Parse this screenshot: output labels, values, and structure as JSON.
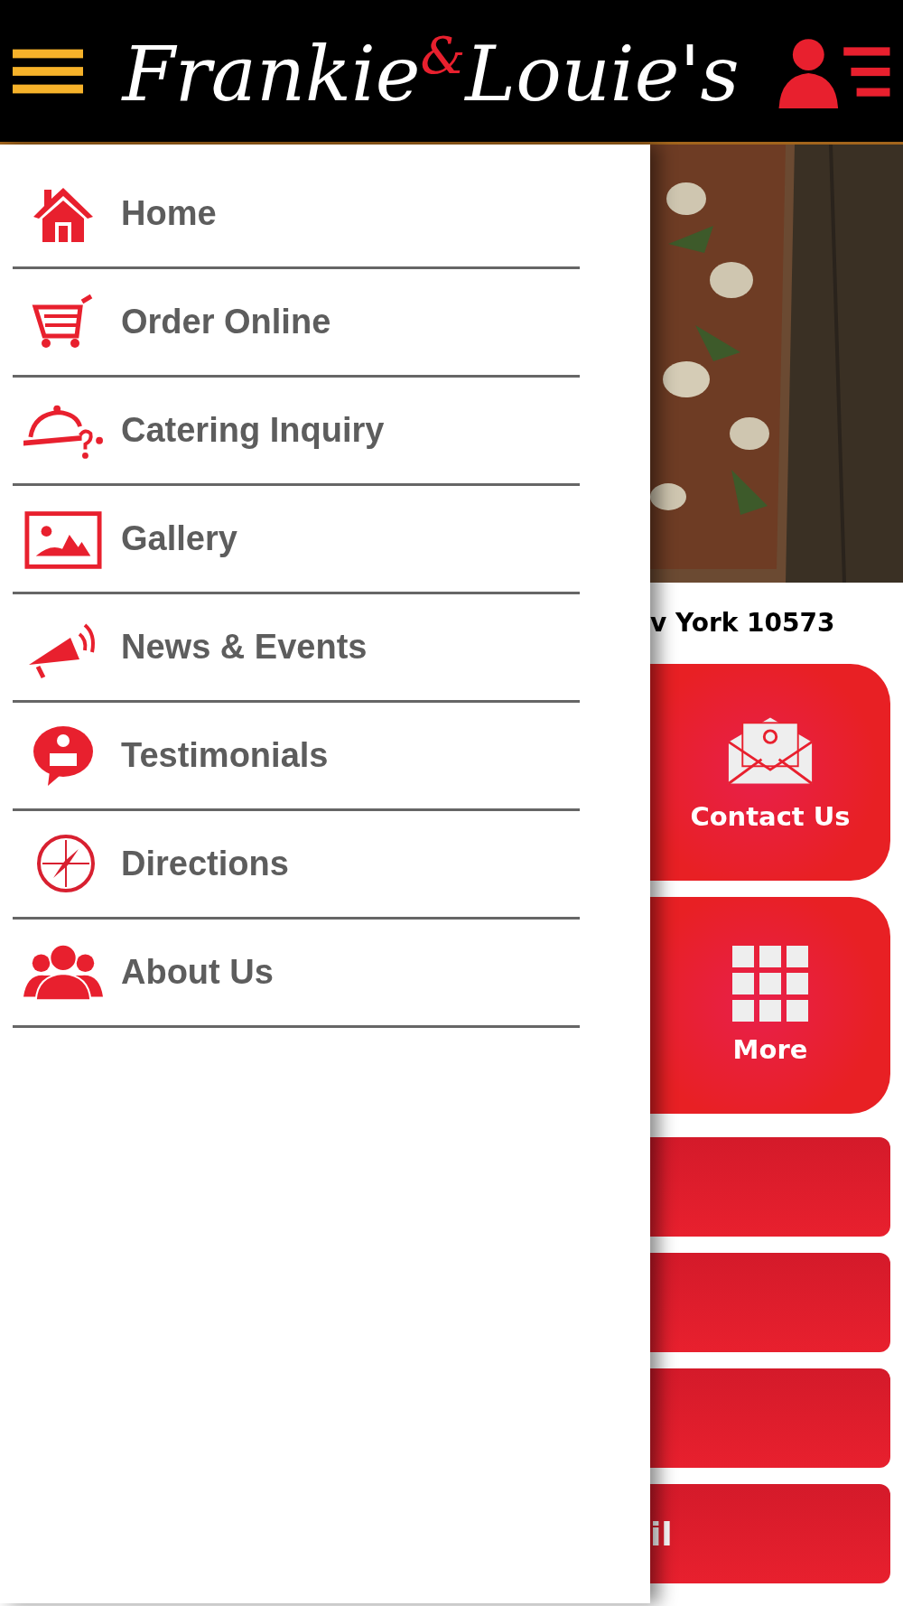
{
  "header": {
    "logo": [
      {
        "text": "Frankie",
        "kind": "plain"
      },
      {
        "text": "&",
        "kind": "accent"
      },
      {
        "text": "Louie's",
        "kind": "plain"
      }
    ]
  },
  "drawer": {
    "items": [
      {
        "label": "Home",
        "kind": "home"
      },
      {
        "label": "Order Online",
        "kind": "cart"
      },
      {
        "label": "Catering Inquiry",
        "kind": "catering"
      },
      {
        "label": "Gallery",
        "kind": "gallery"
      },
      {
        "label": "News & Events",
        "kind": "megaphone"
      },
      {
        "label": "Testimonials",
        "kind": "testimonial"
      },
      {
        "label": "Directions",
        "kind": "compass"
      },
      {
        "label": "About Us",
        "kind": "people"
      }
    ]
  },
  "page": {
    "address": "v York 10573",
    "tiles": [
      {
        "label": "Contact Us",
        "kind": "mail"
      },
      {
        "label": "More",
        "kind": "grid"
      }
    ],
    "bars": [
      {
        "kind": "blank"
      },
      {
        "kind": "blank"
      },
      {
        "kind": "blank"
      },
      {
        "kind": "text",
        "label": "il"
      }
    ]
  }
}
